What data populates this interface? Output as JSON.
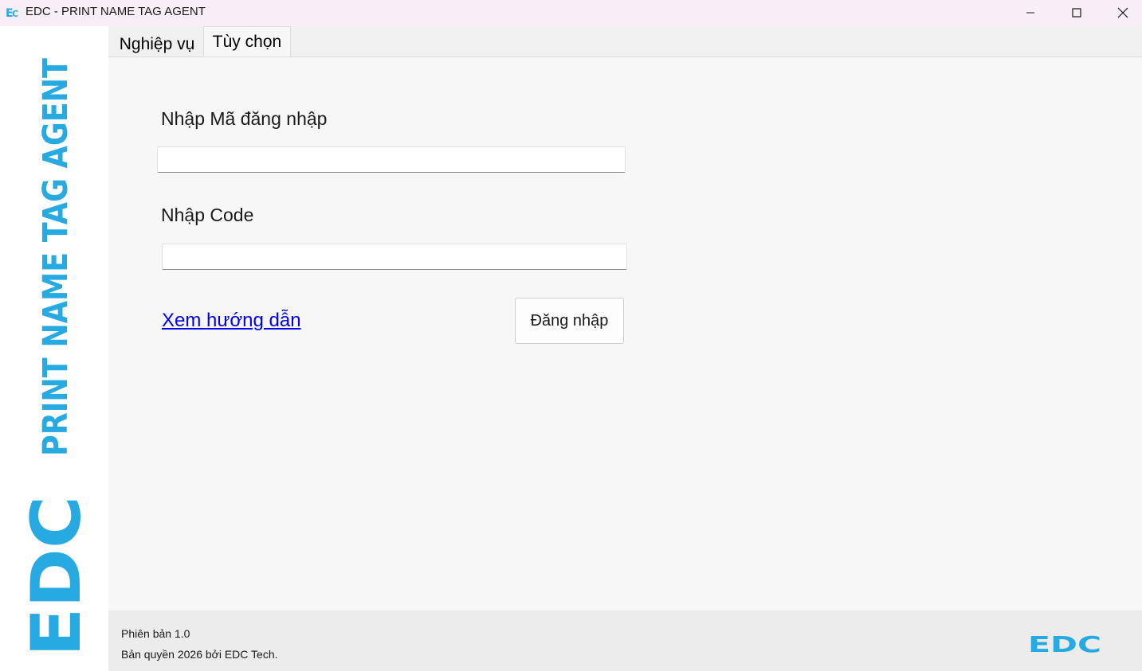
{
  "window": {
    "title": "EDC - PRINT NAME TAG AGENT",
    "icons": {
      "app": "edc-logo-icon",
      "minimize": "minimize-icon",
      "maximize": "maximize-icon",
      "close": "close-icon"
    }
  },
  "banner": {
    "logo_text": "EDC",
    "product_text": "PRINT NAME TAG AGENT",
    "color": "#27a9e1"
  },
  "tabs": [
    {
      "label": "Nghiệp vụ",
      "active": false
    },
    {
      "label": "Tùy chọn",
      "active": true
    }
  ],
  "form": {
    "login_code_label": "Nhập Mã đăng nhập",
    "login_code_value": "",
    "code_label": "Nhập Code",
    "code_value": "",
    "guide_link": "Xem hướng dẫn",
    "login_button": "Đăng nhập"
  },
  "footer": {
    "version": "Phiên bản 1.0",
    "copyright": "Bản quyền 2026 bởi EDC Tech.",
    "logo_text": "EDC"
  },
  "colors": {
    "brand": "#27a9e1",
    "link": "#0000ee",
    "titlebar": "#f8eef5",
    "content_bg": "#f7f7f7",
    "footer_bg": "#ececec"
  }
}
